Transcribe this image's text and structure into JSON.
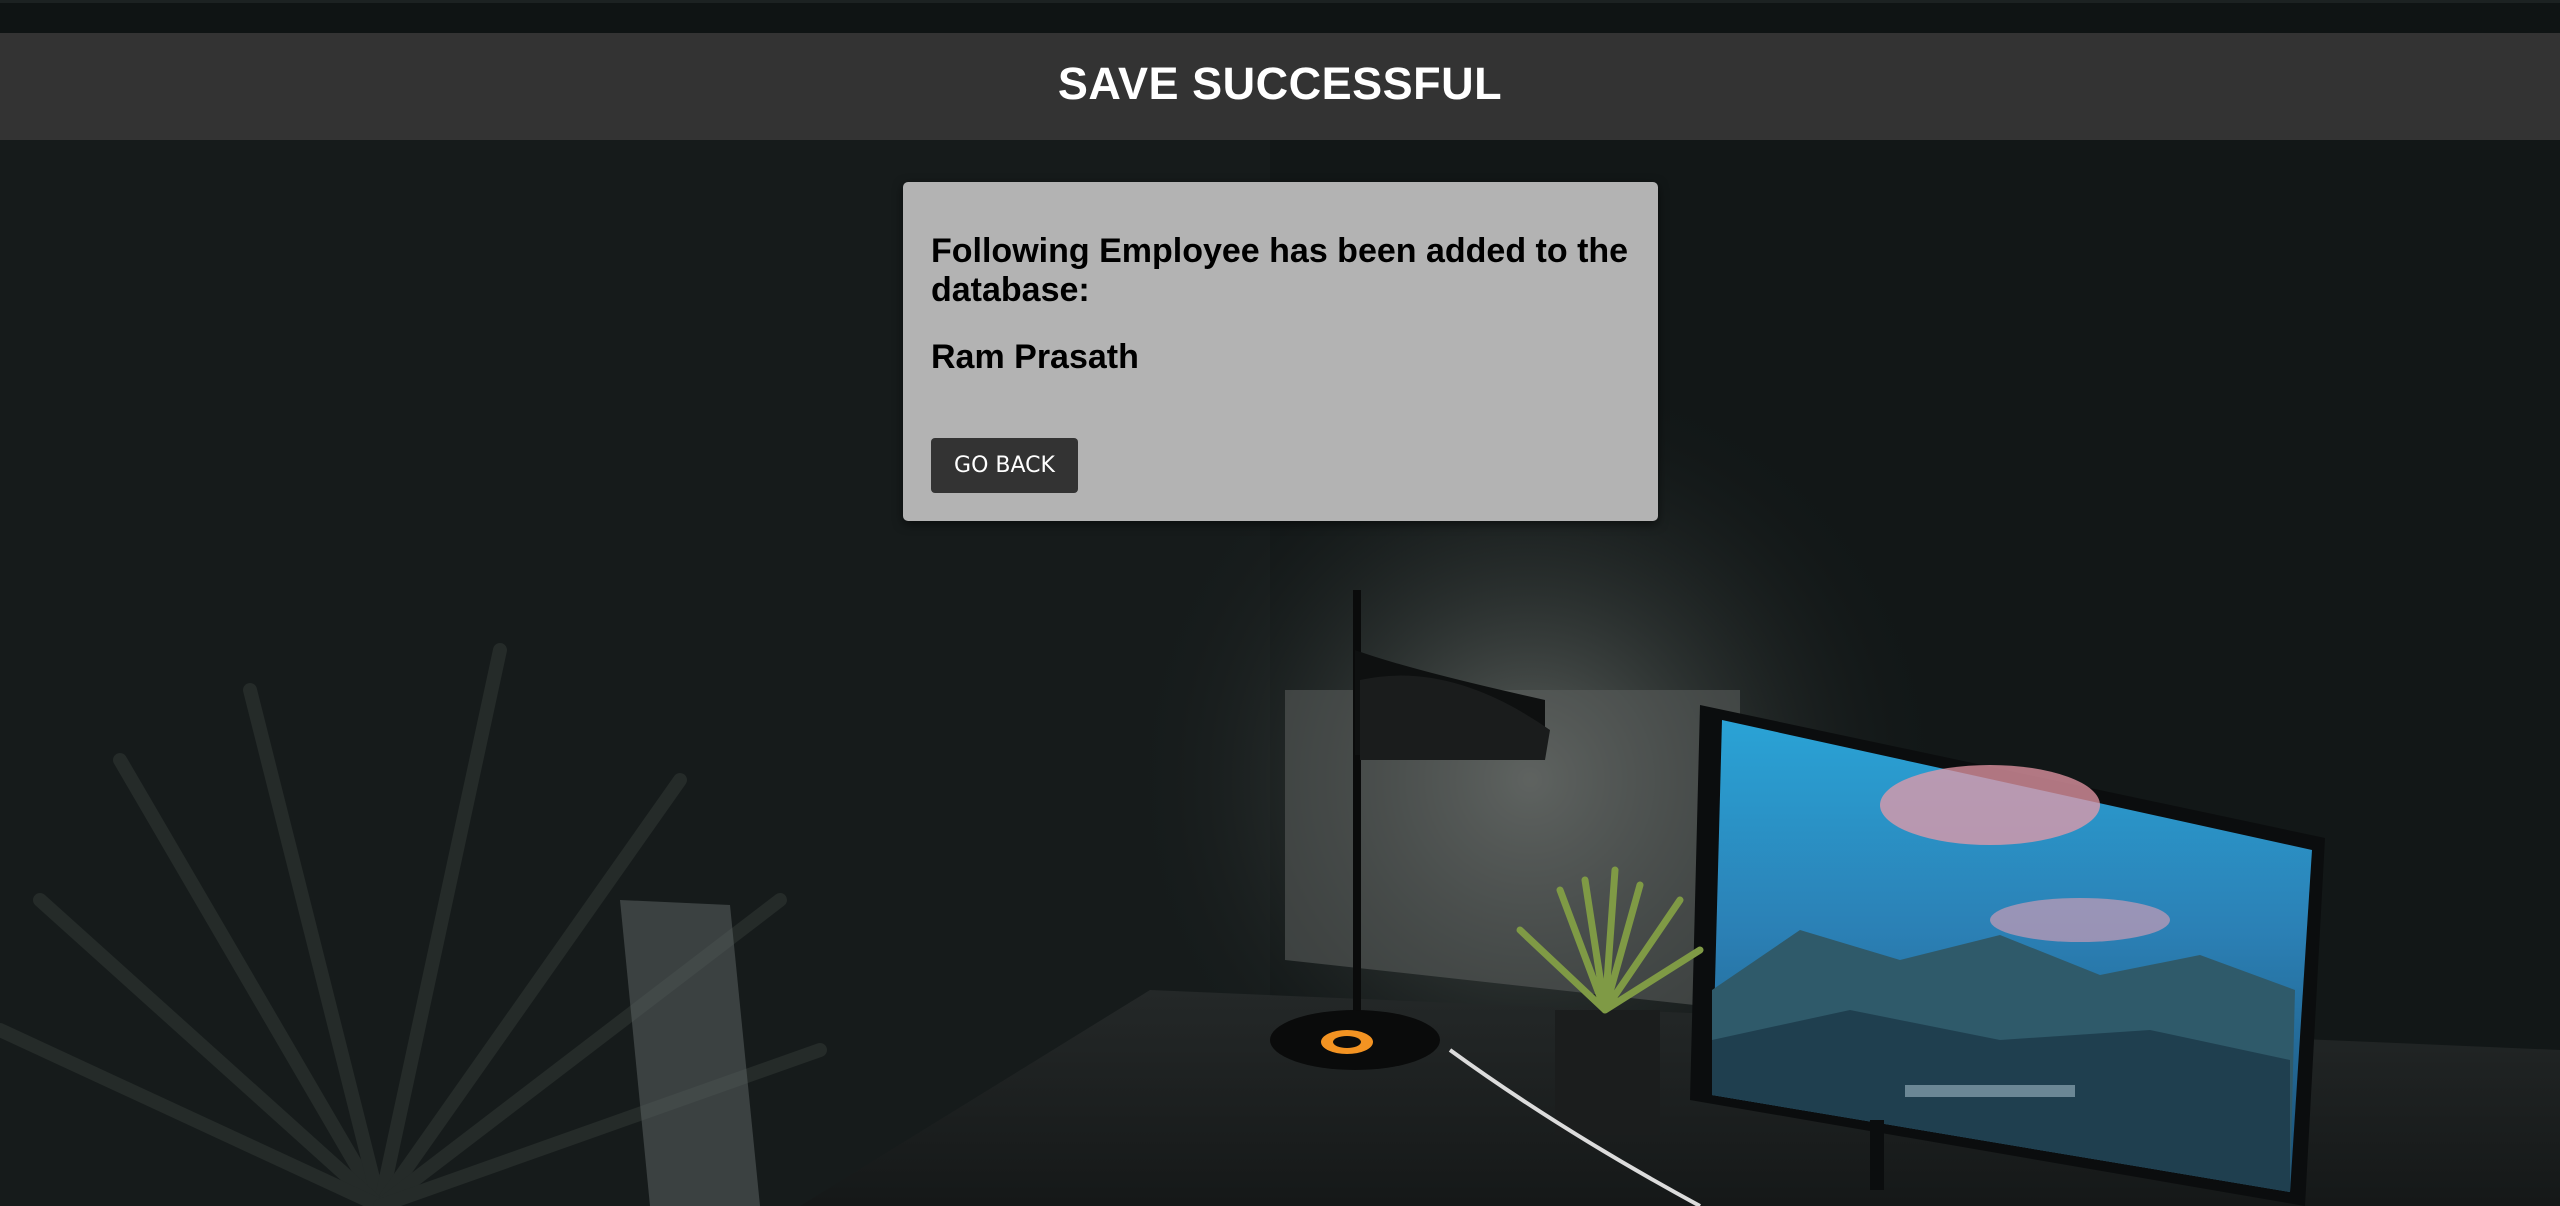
{
  "header": {
    "title": "SAVE SUCCESSFUL"
  },
  "card": {
    "message": "Following Employee has been added to the database:",
    "employee_name": "Ram Prasath",
    "button_label": "GO BACK"
  },
  "colors": {
    "header_bg": "#333333",
    "header_text": "#ffffff",
    "card_bg": "#b3b3b3",
    "button_bg": "#333333",
    "button_text": "#ffffff",
    "page_bg": "#121717"
  },
  "background": {
    "description_icon": "desk-scene-photo"
  }
}
